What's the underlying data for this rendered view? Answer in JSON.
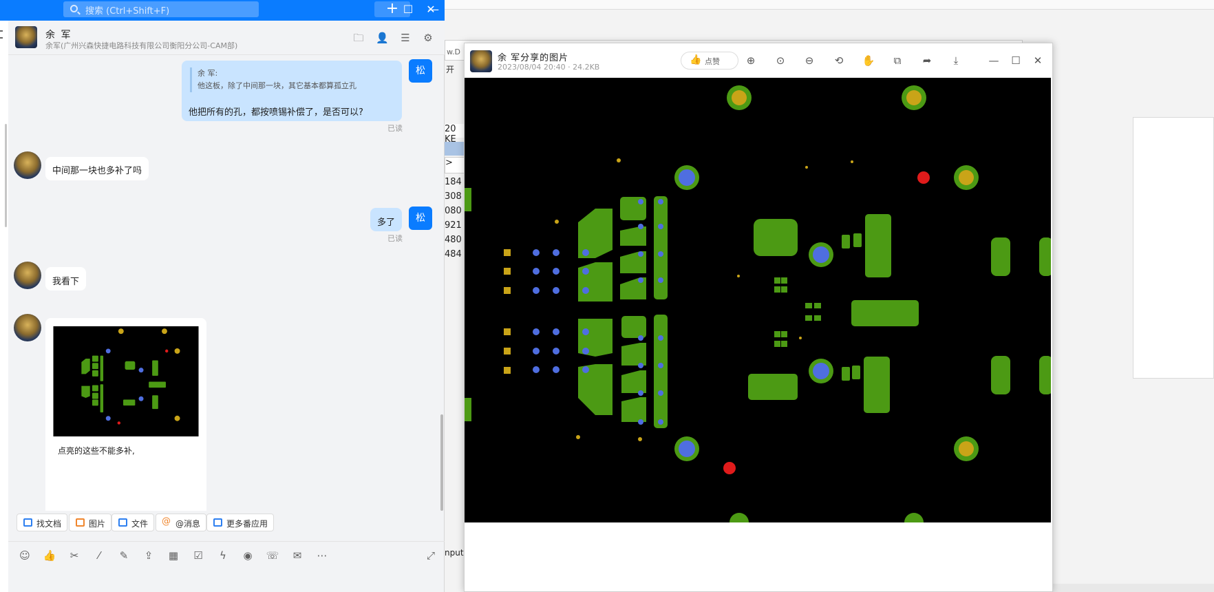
{
  "chat": {
    "search_placeholder": "搜索 (Ctrl+Shift+F)",
    "plus": "+",
    "window": {
      "minimize": "—",
      "maximize": "☐",
      "close": "✕"
    },
    "contact_name": "余 军",
    "contact_org": "余军(广州兴森快捷电路科技有限公司衡阳分公司-CAM部)",
    "my_avatar_text": "松",
    "messages": {
      "m1_quote_author": "余 军:",
      "m1_quote_text": "他这板，除了中间那一块，其它基本都算孤立孔",
      "m1_text": "他把所有的孔，都按喷锡补偿了，是否可以?",
      "m1_status": "已读",
      "m2_text": "中间那一块也多补了吗",
      "m3_text": "多了",
      "m3_status": "已读",
      "m4_text": "我看下",
      "m5_caption": "点亮的这些不能多补,"
    },
    "apps": [
      "找文档",
      "图片",
      "文件",
      "@消息",
      "更多番应用"
    ]
  },
  "viewer": {
    "title": "余 军分享的图片",
    "meta": "2023/08/04 20:40 · 24.2KB",
    "like_label": "点赞",
    "window": {
      "minimize": "—",
      "maximize": "☐",
      "close": "✕"
    }
  },
  "background": {
    "addr": "w.D",
    "menu": "开",
    "size_label": "20 KE",
    "row_marker": ">",
    "numbers": [
      "184",
      "308",
      "080",
      "921",
      "480",
      "484"
    ],
    "input_text": "nput>"
  }
}
